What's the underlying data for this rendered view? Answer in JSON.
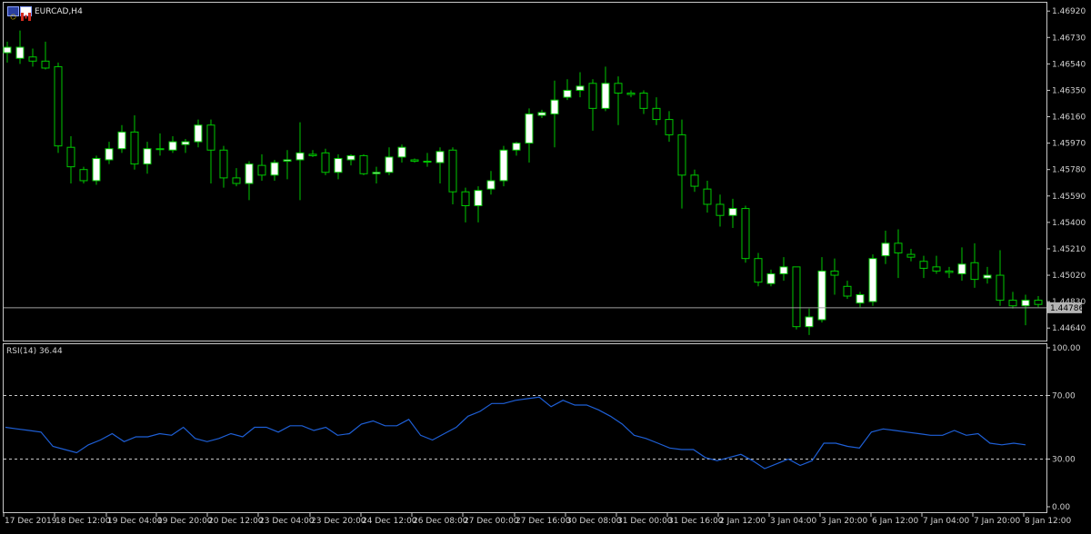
{
  "window": {
    "title": "EURCAD,H4"
  },
  "indicator": {
    "label": "RSI(14) 36.44"
  },
  "current_price_label": "1.44786",
  "colors": {
    "background": "#000000",
    "frame": "#c8c8c8",
    "bull_body": "#ffffff",
    "bear_body": "#000000",
    "wick": "#00c800",
    "rsi_line": "#1e5fd6",
    "level_line": "#c8c8c8",
    "price_line": "#a0a0a0"
  },
  "chart_data": [
    {
      "type": "candlestick",
      "title": "EURCAD,H4",
      "ylim": [
        1.4455,
        1.4698
      ],
      "y_ticks": [
        "1.46920",
        "1.46730",
        "1.46540",
        "1.46350",
        "1.46160",
        "1.45970",
        "1.45780",
        "1.45590",
        "1.45400",
        "1.45210",
        "1.45020",
        "1.44830",
        "1.44640"
      ],
      "current_price": 1.44786,
      "x_tick_labels": [
        "17 Dec 2019",
        "18 Dec 12:00",
        "19 Dec 04:00",
        "19 Dec 20:00",
        "20 Dec 12:00",
        "23 Dec 04:00",
        "23 Dec 20:00",
        "24 Dec 12:00",
        "26 Dec 08:00",
        "27 Dec 00:00",
        "27 Dec 16:00",
        "30 Dec 08:00",
        "31 Dec 00:00",
        "31 Dec 16:00",
        "2 Jan 12:00",
        "3 Jan 04:00",
        "3 Jan 20:00",
        "6 Jan 12:00",
        "7 Jan 04:00",
        "7 Jan 20:00",
        "8 Jan 12:00"
      ],
      "candles": [
        {
          "o": 1.4662,
          "h": 1.467,
          "l": 1.4655,
          "c": 1.4666
        },
        {
          "o": 1.4658,
          "h": 1.4678,
          "l": 1.4654,
          "c": 1.4666
        },
        {
          "o": 1.4659,
          "h": 1.4665,
          "l": 1.4652,
          "c": 1.4656
        },
        {
          "o": 1.4656,
          "h": 1.467,
          "l": 1.465,
          "c": 1.4651
        },
        {
          "o": 1.4652,
          "h": 1.4655,
          "l": 1.459,
          "c": 1.4595
        },
        {
          "o": 1.4594,
          "h": 1.4602,
          "l": 1.4568,
          "c": 1.458
        },
        {
          "o": 1.4578,
          "h": 1.458,
          "l": 1.4568,
          "c": 1.457
        },
        {
          "o": 1.457,
          "h": 1.4588,
          "l": 1.4567,
          "c": 1.4586
        },
        {
          "o": 1.4585,
          "h": 1.4598,
          "l": 1.4582,
          "c": 1.4593
        },
        {
          "o": 1.4593,
          "h": 1.461,
          "l": 1.459,
          "c": 1.4605
        },
        {
          "o": 1.4605,
          "h": 1.4617,
          "l": 1.4578,
          "c": 1.4582
        },
        {
          "o": 1.4582,
          "h": 1.4598,
          "l": 1.4575,
          "c": 1.4593
        },
        {
          "o": 1.4593,
          "h": 1.4604,
          "l": 1.4588,
          "c": 1.4593
        },
        {
          "o": 1.4592,
          "h": 1.4602,
          "l": 1.459,
          "c": 1.4598
        },
        {
          "o": 1.4596,
          "h": 1.46,
          "l": 1.459,
          "c": 1.4598
        },
        {
          "o": 1.4598,
          "h": 1.4614,
          "l": 1.4594,
          "c": 1.461
        },
        {
          "o": 1.461,
          "h": 1.4614,
          "l": 1.4568,
          "c": 1.4592
        },
        {
          "o": 1.4592,
          "h": 1.4595,
          "l": 1.4565,
          "c": 1.4572
        },
        {
          "o": 1.4572,
          "h": 1.4579,
          "l": 1.4566,
          "c": 1.4568
        },
        {
          "o": 1.4568,
          "h": 1.4584,
          "l": 1.4556,
          "c": 1.4582
        },
        {
          "o": 1.4581,
          "h": 1.4589,
          "l": 1.457,
          "c": 1.4574
        },
        {
          "o": 1.4574,
          "h": 1.4585,
          "l": 1.457,
          "c": 1.4583
        },
        {
          "o": 1.4584,
          "h": 1.4592,
          "l": 1.4571,
          "c": 1.4585
        },
        {
          "o": 1.4585,
          "h": 1.4612,
          "l": 1.4556,
          "c": 1.459
        },
        {
          "o": 1.4589,
          "h": 1.4592,
          "l": 1.4587,
          "c": 1.4588
        },
        {
          "o": 1.459,
          "h": 1.4593,
          "l": 1.4574,
          "c": 1.4576
        },
        {
          "o": 1.4576,
          "h": 1.4589,
          "l": 1.4571,
          "c": 1.4586
        },
        {
          "o": 1.4585,
          "h": 1.4589,
          "l": 1.4581,
          "c": 1.4588
        },
        {
          "o": 1.4588,
          "h": 1.4589,
          "l": 1.4574,
          "c": 1.4575
        },
        {
          "o": 1.4575,
          "h": 1.458,
          "l": 1.4568,
          "c": 1.4576
        },
        {
          "o": 1.4576,
          "h": 1.4594,
          "l": 1.4574,
          "c": 1.4587
        },
        {
          "o": 1.4587,
          "h": 1.4596,
          "l": 1.4583,
          "c": 1.4594
        },
        {
          "o": 1.4585,
          "h": 1.4586,
          "l": 1.4583,
          "c": 1.4584
        },
        {
          "o": 1.4584,
          "h": 1.459,
          "l": 1.458,
          "c": 1.4584
        },
        {
          "o": 1.4583,
          "h": 1.4594,
          "l": 1.4568,
          "c": 1.4591
        },
        {
          "o": 1.4592,
          "h": 1.4594,
          "l": 1.4553,
          "c": 1.4562
        },
        {
          "o": 1.4562,
          "h": 1.4565,
          "l": 1.454,
          "c": 1.4552
        },
        {
          "o": 1.4552,
          "h": 1.4566,
          "l": 1.454,
          "c": 1.4563
        },
        {
          "o": 1.4564,
          "h": 1.4577,
          "l": 1.456,
          "c": 1.457
        },
        {
          "o": 1.457,
          "h": 1.4595,
          "l": 1.4566,
          "c": 1.4592
        },
        {
          "o": 1.4592,
          "h": 1.4598,
          "l": 1.4588,
          "c": 1.4597
        },
        {
          "o": 1.4597,
          "h": 1.4622,
          "l": 1.4583,
          "c": 1.4618
        },
        {
          "o": 1.4617,
          "h": 1.4621,
          "l": 1.4615,
          "c": 1.4619
        },
        {
          "o": 1.4618,
          "h": 1.4642,
          "l": 1.4594,
          "c": 1.4628
        },
        {
          "o": 1.463,
          "h": 1.4643,
          "l": 1.4628,
          "c": 1.4635
        },
        {
          "o": 1.4635,
          "h": 1.4648,
          "l": 1.463,
          "c": 1.4638
        },
        {
          "o": 1.464,
          "h": 1.4643,
          "l": 1.4606,
          "c": 1.4622
        },
        {
          "o": 1.4622,
          "h": 1.4652,
          "l": 1.462,
          "c": 1.464
        },
        {
          "o": 1.464,
          "h": 1.4645,
          "l": 1.461,
          "c": 1.4633
        },
        {
          "o": 1.4633,
          "h": 1.4635,
          "l": 1.463,
          "c": 1.4632
        },
        {
          "o": 1.4633,
          "h": 1.4635,
          "l": 1.4618,
          "c": 1.4622
        },
        {
          "o": 1.4622,
          "h": 1.463,
          "l": 1.461,
          "c": 1.4614
        },
        {
          "o": 1.4614,
          "h": 1.462,
          "l": 1.4598,
          "c": 1.4603
        },
        {
          "o": 1.4603,
          "h": 1.4614,
          "l": 1.455,
          "c": 1.4574
        },
        {
          "o": 1.4574,
          "h": 1.4578,
          "l": 1.4562,
          "c": 1.4566
        },
        {
          "o": 1.4564,
          "h": 1.457,
          "l": 1.4547,
          "c": 1.4553
        },
        {
          "o": 1.4553,
          "h": 1.456,
          "l": 1.4537,
          "c": 1.4545
        },
        {
          "o": 1.4545,
          "h": 1.4557,
          "l": 1.4536,
          "c": 1.455
        },
        {
          "o": 1.455,
          "h": 1.4552,
          "l": 1.4511,
          "c": 1.4514
        },
        {
          "o": 1.4514,
          "h": 1.4518,
          "l": 1.4494,
          "c": 1.4497
        },
        {
          "o": 1.4496,
          "h": 1.4506,
          "l": 1.4494,
          "c": 1.4503
        },
        {
          "o": 1.4503,
          "h": 1.4515,
          "l": 1.4498,
          "c": 1.4508
        },
        {
          "o": 1.4508,
          "h": 1.4508,
          "l": 1.4463,
          "c": 1.4465
        },
        {
          "o": 1.4465,
          "h": 1.4478,
          "l": 1.4459,
          "c": 1.4472
        },
        {
          "o": 1.447,
          "h": 1.4515,
          "l": 1.4468,
          "c": 1.4505
        },
        {
          "o": 1.4505,
          "h": 1.4514,
          "l": 1.4488,
          "c": 1.4502
        },
        {
          "o": 1.4494,
          "h": 1.4498,
          "l": 1.4485,
          "c": 1.4487
        },
        {
          "o": 1.4482,
          "h": 1.449,
          "l": 1.4479,
          "c": 1.4488
        },
        {
          "o": 1.4483,
          "h": 1.4517,
          "l": 1.448,
          "c": 1.4514
        },
        {
          "o": 1.4516,
          "h": 1.4534,
          "l": 1.451,
          "c": 1.4525
        },
        {
          "o": 1.4525,
          "h": 1.4535,
          "l": 1.45,
          "c": 1.4518
        },
        {
          "o": 1.4517,
          "h": 1.4521,
          "l": 1.4512,
          "c": 1.4515
        },
        {
          "o": 1.4512,
          "h": 1.4516,
          "l": 1.45,
          "c": 1.4507
        },
        {
          "o": 1.4508,
          "h": 1.4516,
          "l": 1.4503,
          "c": 1.4505
        },
        {
          "o": 1.4505,
          "h": 1.4508,
          "l": 1.45,
          "c": 1.4504
        },
        {
          "o": 1.4503,
          "h": 1.4522,
          "l": 1.4498,
          "c": 1.451
        },
        {
          "o": 1.4511,
          "h": 1.4525,
          "l": 1.4493,
          "c": 1.4499
        },
        {
          "o": 1.45,
          "h": 1.4508,
          "l": 1.4496,
          "c": 1.4502
        },
        {
          "o": 1.4502,
          "h": 1.452,
          "l": 1.448,
          "c": 1.4484
        },
        {
          "o": 1.4484,
          "h": 1.449,
          "l": 1.4478,
          "c": 1.448
        },
        {
          "o": 1.448,
          "h": 1.4488,
          "l": 1.4466,
          "c": 1.4484
        },
        {
          "o": 1.4484,
          "h": 1.4487,
          "l": 1.4479,
          "c": 1.4481
        }
      ]
    },
    {
      "type": "line",
      "title": "RSI(14) 36.44",
      "ylim": [
        0,
        100
      ],
      "y_ticks": [
        "100.00",
        "70.00",
        "30.00",
        "0.00"
      ],
      "levels": [
        70,
        30
      ],
      "series": [
        {
          "values": [
            50,
            49,
            48,
            47,
            38,
            36,
            34,
            39,
            42,
            46,
            41,
            44,
            44,
            46,
            45,
            50,
            43,
            41,
            43,
            46,
            44,
            50,
            50,
            47,
            51,
            51,
            48,
            50,
            45,
            46,
            52,
            54,
            51,
            51,
            55,
            45,
            42,
            46,
            50,
            57,
            60,
            65,
            65,
            67,
            68,
            69,
            63,
            67,
            64,
            64,
            61,
            57,
            52,
            45,
            43,
            40,
            37,
            36,
            36,
            31,
            29,
            31,
            33,
            29,
            24,
            27,
            30,
            26,
            29,
            40,
            40,
            38,
            37,
            47,
            49,
            48,
            47,
            46,
            45,
            45,
            48,
            45,
            46,
            40,
            39,
            40,
            39
          ]
        }
      ]
    }
  ]
}
